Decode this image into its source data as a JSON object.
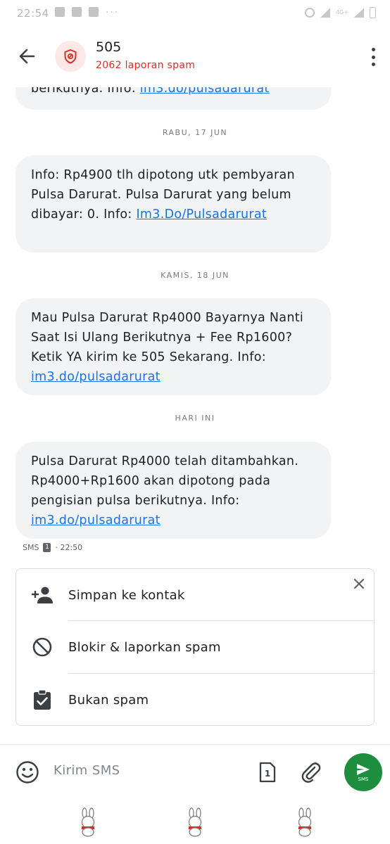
{
  "status_bar": {
    "time": "22:54",
    "network": "4G+"
  },
  "header": {
    "contact_name": "505",
    "spam_reports": "2062 laporan spam",
    "avatar_icon": "shield-alert-icon",
    "back_icon": "arrow-back-icon",
    "more_icon": "more-vert-icon"
  },
  "messages": [
    {
      "text": "berikutnya. Info: ",
      "link": "im3.do/pulsadarurat"
    },
    {
      "date": "RABU, 17 JUN",
      "text": "Info: Rp4900 tlh dipotong utk pembyaran Pulsa Darurat. Pulsa Darurat yang belum dibayar: 0. Info: ",
      "link": "Im3.Do/Pulsadarurat"
    },
    {
      "date": "KAMIS, 18 JUN",
      "text": "Mau Pulsa Darurat Rp4000 Bayarnya Nanti Saat Isi Ulang Berikutnya + Fee Rp1600? Ketik YA kirim ke 505 Sekarang. Info: ",
      "link": "im3.do/pulsadarurat"
    },
    {
      "date": "HARI INI",
      "text": "Pulsa Darurat Rp4000 telah ditambahkan. Rp4000+Rp1600 akan dipotong pada pengisian pulsa berikutnya. Info: ",
      "link": "im3.do/pulsadarurat"
    }
  ],
  "message_meta": {
    "type": "SMS",
    "sim": "1",
    "time": "· 22:50"
  },
  "spam_card": {
    "close_icon": "close-icon",
    "actions": [
      {
        "label": "Simpan ke kontak",
        "icon": "person-add-icon"
      },
      {
        "label": "Blokir & laporkan spam",
        "icon": "block-icon"
      },
      {
        "label": "Bukan spam",
        "icon": "clipboard-check-icon"
      }
    ]
  },
  "compose": {
    "placeholder": "Kirim SMS",
    "sim_label": "1",
    "send_label": "SMS"
  },
  "colors": {
    "accent": "#1a73e8",
    "spam_red": "#d93025",
    "send_green": "#1e8e3e",
    "bubble_bg": "#f1f3f4"
  }
}
